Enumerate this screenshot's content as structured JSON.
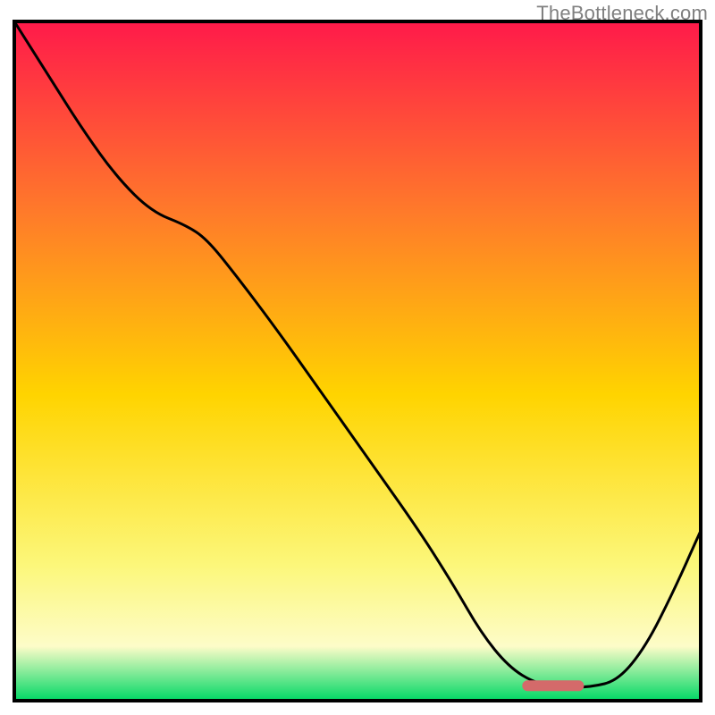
{
  "watermark": "TheBottleneck.com",
  "colors": {
    "gradient_top": "#ff1a4a",
    "gradient_mid_upper": "#ff7a2a",
    "gradient_mid": "#ffd400",
    "gradient_lower": "#fcf77a",
    "gradient_pale": "#fdfcc8",
    "gradient_bottom": "#00d865",
    "curve": "#000000",
    "marker": "#d46a6a",
    "frame": "#000000"
  },
  "chart_data": {
    "type": "line",
    "title": "",
    "xlabel": "",
    "ylabel": "",
    "xlim": [
      0,
      100
    ],
    "ylim": [
      0,
      100
    ],
    "x": [
      0,
      5,
      10,
      15,
      20,
      25,
      28,
      32,
      38,
      45,
      52,
      59,
      64,
      68,
      72,
      76,
      80,
      84,
      88,
      92,
      96,
      100
    ],
    "values": [
      100,
      92,
      84,
      77,
      72,
      70,
      68,
      63,
      55,
      45,
      35,
      25,
      17,
      10,
      5,
      2.5,
      2,
      2,
      3,
      8,
      16,
      25
    ],
    "marker": {
      "x_start": 74,
      "x_end": 83,
      "y": 2.2
    },
    "note": "x and y are percentages of the plotting area; higher y = higher up. Values estimated from pixel positions."
  }
}
